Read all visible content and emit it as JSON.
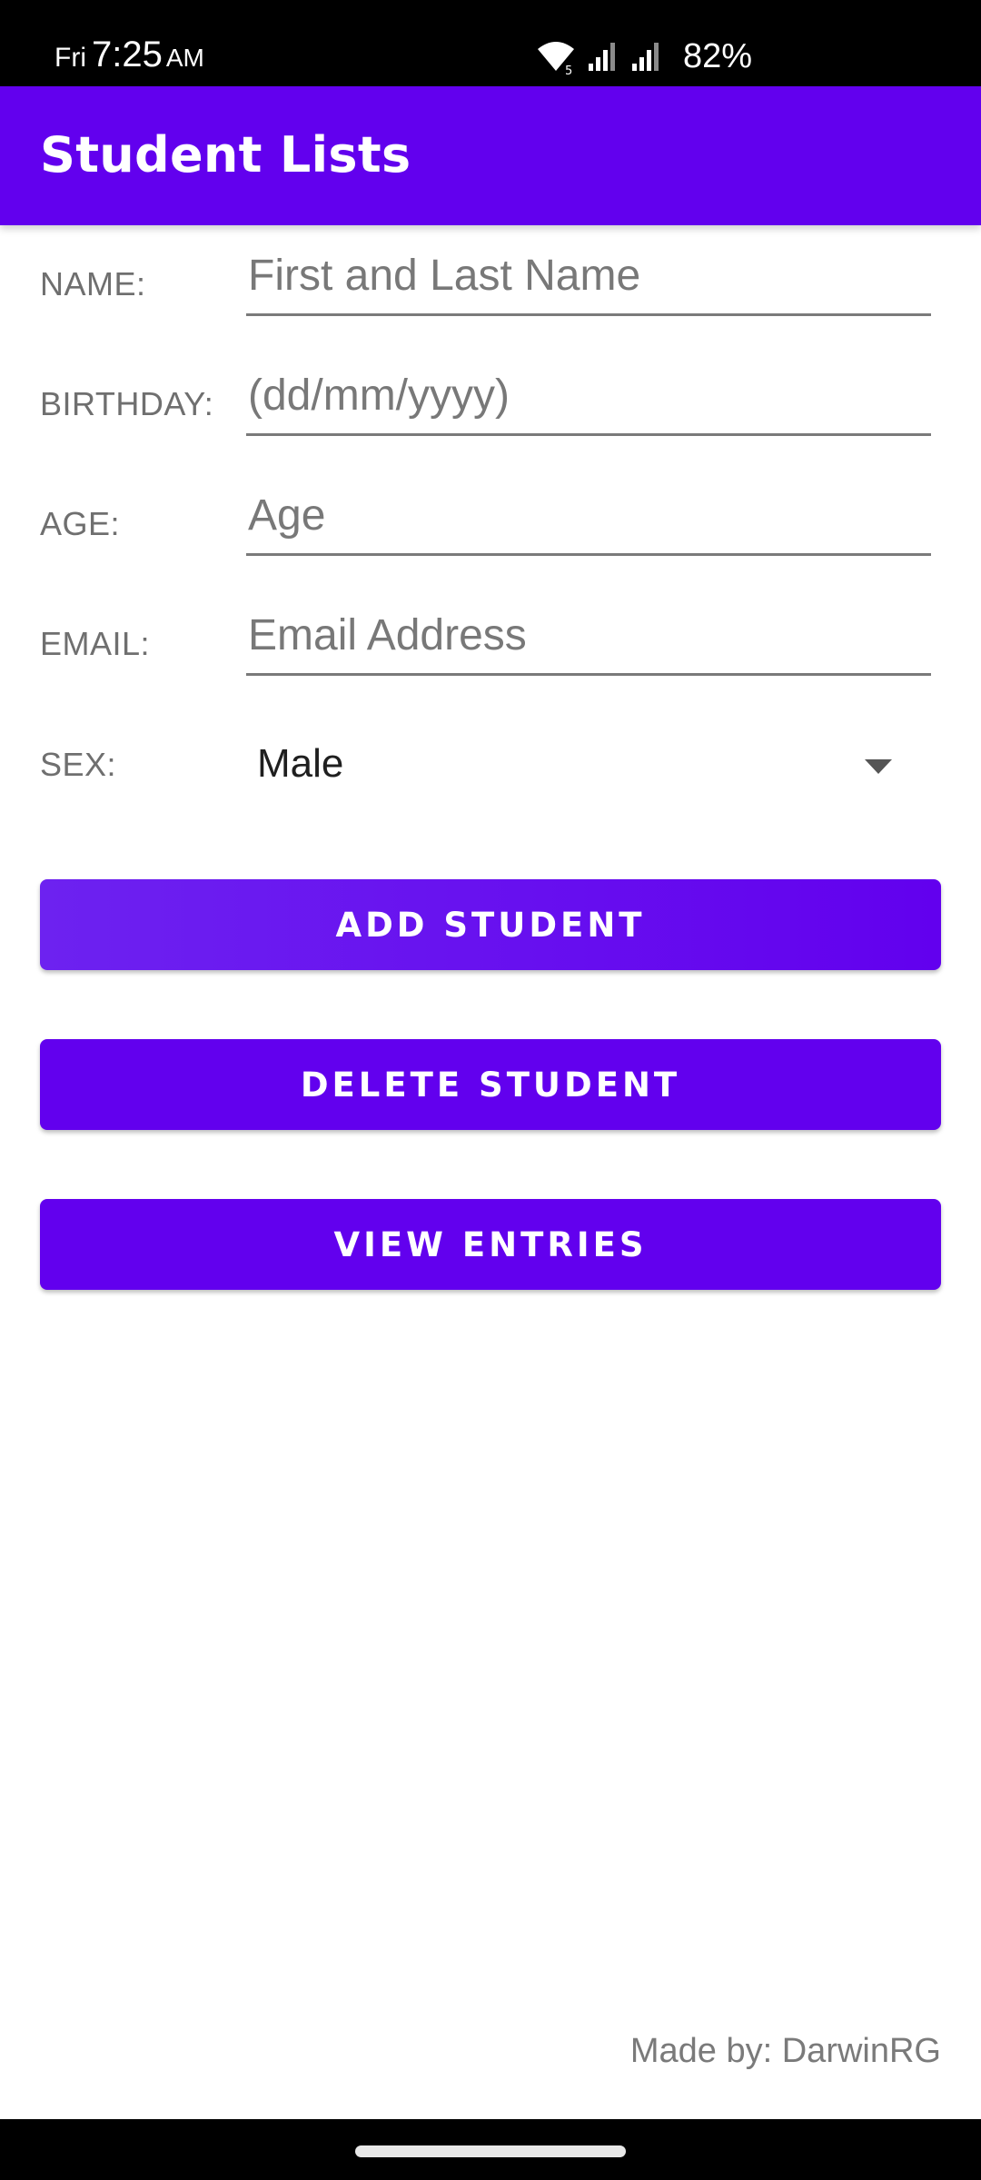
{
  "status_bar": {
    "day": "Fri",
    "time": "7:25",
    "ampm": "AM",
    "battery": "82%",
    "icons": [
      "wifi-icon",
      "signal-icon",
      "signal-icon",
      "battery-text"
    ]
  },
  "app_bar": {
    "title": "Student Lists"
  },
  "form": {
    "name": {
      "label": "NAME:",
      "placeholder": "First and Last Name",
      "value": ""
    },
    "birthday": {
      "label": "BIRTHDAY:",
      "placeholder": "(dd/mm/yyyy)",
      "value": ""
    },
    "age": {
      "label": "AGE:",
      "placeholder": "Age",
      "value": ""
    },
    "email": {
      "label": "EMAIL:",
      "placeholder": "Email Address",
      "value": ""
    },
    "sex": {
      "label": "SEX:",
      "selected": "Male"
    }
  },
  "buttons": {
    "add": "ADD STUDENT",
    "delete": "DELETE STUDENT",
    "view": "VIEW ENTRIES"
  },
  "footer": {
    "credit": "Made by: DarwinRG"
  },
  "colors": {
    "primary": "#6200ee",
    "status_bar": "#000000",
    "label_gray": "#6f6f6f"
  }
}
